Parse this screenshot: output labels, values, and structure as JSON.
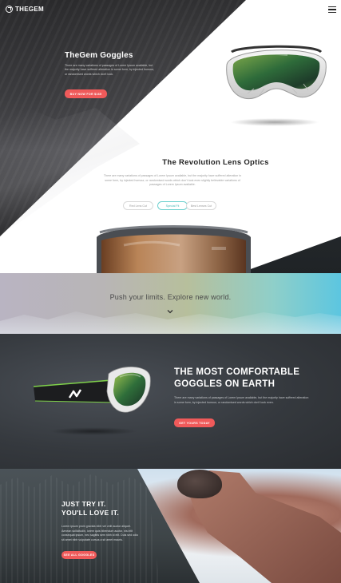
{
  "brand": {
    "name": "THEGEM"
  },
  "hero": {
    "title": "TheGem Goggles",
    "description": "There are many variations of passages of Lorem Ipsum available, but the majority have suffered alteration in some form, by injected humour, or randomised words which don't look.",
    "button": "Buy now for $165"
  },
  "revolution": {
    "title": "The Revolution Lens Optics",
    "description": "There are many variations of passages of Lorem Ipsum available, but the majority have suffered alteration in some form, by injected humour, or randomised words which don't look even slightly believable variations of passages of Lorem Ipsum available.",
    "lens_options": [
      "Red Lens Cut",
      "Special Fit",
      "Best Lenses Cut"
    ],
    "active_lens": 1
  },
  "band": {
    "text": "Push your limits. Explore new world."
  },
  "comfort": {
    "title_line1": "THE MOST COMFORTABLE",
    "title_line2": "GOGGLES ON EARTH",
    "description": "There are many variations of passages of Lorem Ipsum available, but the majority have suffered alteration in some form, by injected humour, or randomised words which don't look even.",
    "button": "Get yours today"
  },
  "tryit": {
    "title_line1": "JUST TRY IT.",
    "title_line2": "YOU'LL LOVE IT.",
    "description": "Lorem ipsum proin gravida nibh vel velit auctor aliquet. Aenean sollicitudin, lorem quis bibendum auctor, nisi elit consequat ipsum, nec sagittis sem nibh id elit. Duis sed odio sit amet nibh vulputate cursus a sit amet mauris.",
    "button": "See all goggles"
  },
  "colors": {
    "accent": "#f05a5a",
    "teal": "#47b8b6",
    "dark": "#35393e"
  },
  "icons": {
    "logo": "gem-logo-icon",
    "menu": "hamburger-menu-icon",
    "scroll": "chevron-down-icon"
  }
}
